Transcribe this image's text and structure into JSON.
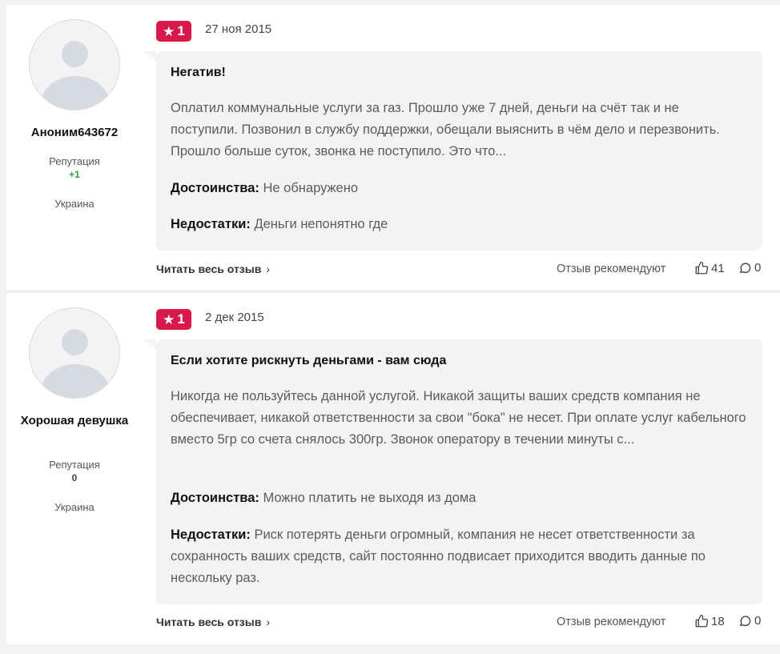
{
  "reviews": [
    {
      "author": "Аноним643672",
      "reputation_label": "Репутация",
      "reputation_value": "+1",
      "country": "Украина",
      "rating": "1",
      "date": "27 ноя 2015",
      "title": "Негатив!",
      "text": "Оплатил коммунальные услуги за газ. Прошло уже 7 дней, деньги на счёт так и не поступили. Позвонил в службу поддержки, обещали выяснить в чём дело и перезвонить. Прошло больше суток, звонка не поступило. Это что...",
      "pros_label": "Достоинства:",
      "pros": "Не обнаружено",
      "cons_label": "Недостатки:",
      "cons": "Деньги непонятно где",
      "read_more": "Читать весь отзыв",
      "recommend_label": "Отзыв рекомендуют",
      "likes": "41",
      "comments": "0"
    },
    {
      "author": "Хорошая девушка",
      "reputation_label": "Репутация",
      "reputation_value": "0",
      "country": "Украина",
      "rating": "1",
      "date": "2 дек 2015",
      "title": "Если хотите рискнуть деньгами - вам сюда",
      "text": "Никогда не пользуйтесь данной услугой. Никакой защиты ваших средств компания не обеспечивает, никакой ответственности за свои \"бока\" не несет. При оплате услуг кабельного вместо 5гр со счета снялось 300гр. Звонок оператору в течении минуты с...",
      "pros_label": "Достоинства:",
      "pros": "Можно платить не выходя из дома",
      "cons_label": "Недостатки:",
      "cons": "Риск потерять деньги огромный, компания не несет ответственности за сохранность ваших средств, сайт постоянно подвисает приходится вводить данные по нескольку раз.",
      "read_more": "Читать весь отзыв",
      "recommend_label": "Отзыв рекомендуют",
      "likes": "18",
      "comments": "0"
    }
  ],
  "colors": {
    "badge": "#d8194a",
    "positive": "#2a9d3a",
    "bubble": "#f2f3f5"
  },
  "icons": [
    "star-icon",
    "thumbs-up-icon",
    "comment-icon",
    "chevron-right-icon",
    "avatar-placeholder-icon"
  ]
}
